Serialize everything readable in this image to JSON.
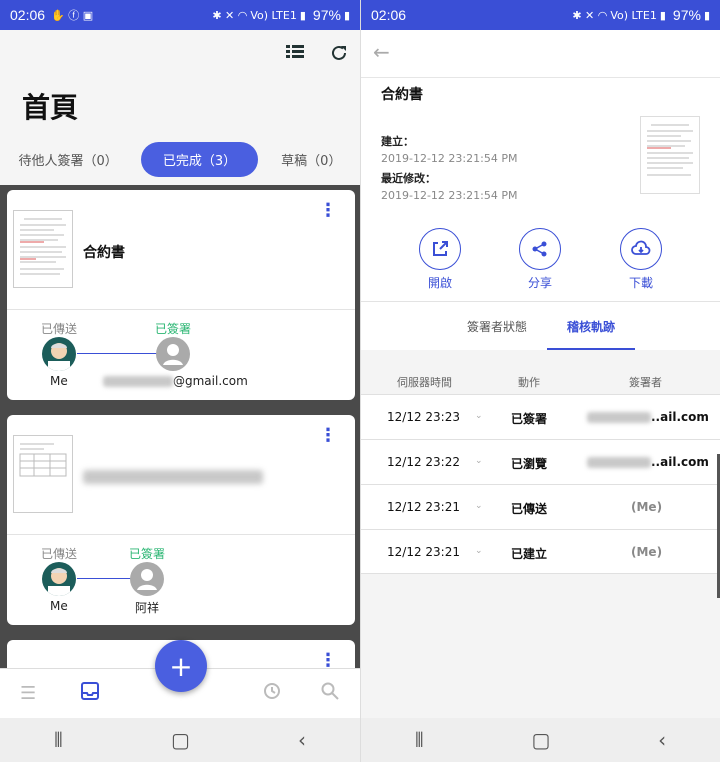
{
  "status_bar": {
    "time": "02:06",
    "battery": "97%",
    "signal_text": "Vo) LTE1"
  },
  "left": {
    "title": "首頁",
    "tabs": [
      "待他人簽署（0）",
      "已完成（3）",
      "草稿（0）"
    ],
    "active_tab": 1,
    "cards": [
      {
        "title": "合約書",
        "flow": {
          "from_label": "已傳送",
          "to_label": "已簽署",
          "from_name": "Me",
          "to_name": "@gmail.com"
        }
      },
      {
        "title": "",
        "flow": {
          "from_label": "已傳送",
          "to_label": "已簽署",
          "from_name": "Me",
          "to_name": "阿祥"
        }
      }
    ],
    "fab_label": "+"
  },
  "right": {
    "doc_title": "合約書",
    "created_label": "建立：",
    "created_value": "2019-12-12 23:21:54 PM",
    "modified_label": "最近修改：",
    "modified_value": "2019-12-12 23:21:54 PM",
    "actions": [
      "開啟",
      "分享",
      "下載"
    ],
    "tabs": [
      "簽署者狀態",
      "稽核軌跡"
    ],
    "active_tab": 1,
    "table": {
      "headers": [
        "伺服器時間",
        "動作",
        "簽署者"
      ],
      "rows": [
        {
          "time": "12/12 23:23",
          "action": "已簽署",
          "signer": "..ail.com"
        },
        {
          "time": "12/12 23:22",
          "action": "已瀏覽",
          "signer": "..ail.com"
        },
        {
          "time": "12/12 23:21",
          "action": "已傳送",
          "signer": "(Me)"
        },
        {
          "time": "12/12 23:21",
          "action": "已建立",
          "signer": "(Me)"
        }
      ]
    }
  },
  "colors": {
    "primary": "#3a4fd6",
    "accent_green": "#2bb673",
    "status_bar": "#3a4fd6"
  }
}
